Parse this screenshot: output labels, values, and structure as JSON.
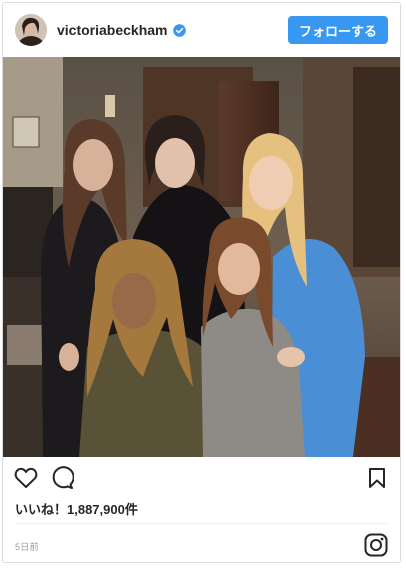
{
  "header": {
    "username": "victoriabeckham",
    "verified": true,
    "follow_label": "フォローする"
  },
  "post": {
    "photo_alt": "Group photo",
    "likes_text": "いいね！1,887,900件",
    "timestamp": "5日前"
  },
  "icons": {
    "verified": "verified-badge-icon",
    "like": "heart-icon",
    "comment": "comment-icon",
    "save": "bookmark-icon",
    "brand": "instagram-icon"
  },
  "colors": {
    "follow_button": "#3897f0",
    "verified_badge": "#3897f0",
    "text_primary": "#262626",
    "text_muted": "#999999"
  }
}
